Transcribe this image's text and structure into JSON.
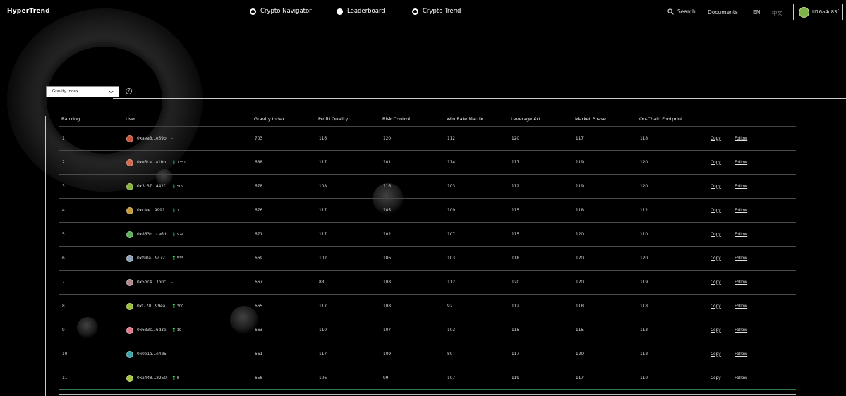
{
  "app": {
    "title": "HyperTrend"
  },
  "nav": {
    "items": [
      {
        "label": "Crypto Navigator",
        "style": "ring"
      },
      {
        "label": "Leaderboard",
        "style": "filled"
      },
      {
        "label": "Crypto Trend",
        "style": "ring"
      }
    ]
  },
  "header": {
    "search_label": "Search",
    "docs_label": "Documents",
    "lang_en": "EN",
    "lang_sep": "|",
    "lang_zh": "中文",
    "account_label": "U76a4c83f"
  },
  "filter": {
    "selected": "Gravity Index",
    "help": "?"
  },
  "table": {
    "columns": [
      "Ranking",
      "User",
      "Gravity Index",
      "Profit Quality",
      "Risk Control",
      "Win Rate Matrix",
      "Leverage Art",
      "Market Phase",
      "On-Chain Footprint"
    ],
    "action_copy": "Copy",
    "action_follow": "Follow",
    "rows": [
      {
        "rank": "1",
        "user": "0xaea8...e59b",
        "avatar": "#c8553d",
        "trend": "-",
        "up": false,
        "gravity": "703",
        "profit": "116",
        "risk": "120",
        "winrate": "112",
        "leverage": "120",
        "market": "117",
        "footprint": "118"
      },
      {
        "rank": "2",
        "user": "0xe6ca...a1bb",
        "avatar": "#d06a4a",
        "trend": "1351",
        "up": true,
        "gravity": "688",
        "profit": "117",
        "risk": "101",
        "winrate": "114",
        "leverage": "117",
        "market": "119",
        "footprint": "120"
      },
      {
        "rank": "3",
        "user": "0x3c37...442f",
        "avatar": "#86b340",
        "trend": "509",
        "up": true,
        "gravity": "678",
        "profit": "108",
        "risk": "116",
        "winrate": "103",
        "leverage": "112",
        "market": "119",
        "footprint": "120"
      },
      {
        "rank": "4",
        "user": "0xcfee...9991",
        "avatar": "#c59a3a",
        "trend": "1",
        "up": true,
        "gravity": "676",
        "profit": "117",
        "risk": "105",
        "winrate": "109",
        "leverage": "115",
        "market": "118",
        "footprint": "112"
      },
      {
        "rank": "5",
        "user": "0x863b...ca6d",
        "avatar": "#5fae5a",
        "trend": "924",
        "up": true,
        "gravity": "671",
        "profit": "117",
        "risk": "102",
        "winrate": "107",
        "leverage": "115",
        "market": "120",
        "footprint": "110"
      },
      {
        "rank": "6",
        "user": "0xf90a...9c72",
        "avatar": "#8fa3b8",
        "trend": "535",
        "up": true,
        "gravity": "669",
        "profit": "102",
        "risk": "106",
        "winrate": "103",
        "leverage": "118",
        "market": "120",
        "footprint": "120"
      },
      {
        "rank": "7",
        "user": "0x5bc4...3b0c",
        "avatar": "#b08a8a",
        "trend": "-",
        "up": false,
        "gravity": "667",
        "profit": "88",
        "risk": "108",
        "winrate": "112",
        "leverage": "120",
        "market": "120",
        "footprint": "119"
      },
      {
        "rank": "8",
        "user": "0xf770...99ea",
        "avatar": "#9bbf3a",
        "trend": "300",
        "up": true,
        "gravity": "665",
        "profit": "117",
        "risk": "108",
        "winrate": "92",
        "leverage": "112",
        "market": "118",
        "footprint": "118"
      },
      {
        "rank": "9",
        "user": "0x683c...6d3e",
        "avatar": "#e07a8a",
        "trend": "10",
        "up": true,
        "gravity": "663",
        "profit": "110",
        "risk": "107",
        "winrate": "103",
        "leverage": "115",
        "market": "115",
        "footprint": "113"
      },
      {
        "rank": "10",
        "user": "0x0e1a...e4d5",
        "avatar": "#3fa3a8",
        "trend": "-",
        "up": false,
        "gravity": "661",
        "profit": "117",
        "risk": "109",
        "winrate": "80",
        "leverage": "117",
        "market": "120",
        "footprint": "118"
      },
      {
        "rank": "11",
        "user": "0xa448...8250",
        "avatar": "#a6c440",
        "trend": "8",
        "up": true,
        "gravity": "658",
        "profit": "106",
        "risk": "99",
        "winrate": "107",
        "leverage": "119",
        "market": "117",
        "footprint": "110"
      }
    ]
  }
}
